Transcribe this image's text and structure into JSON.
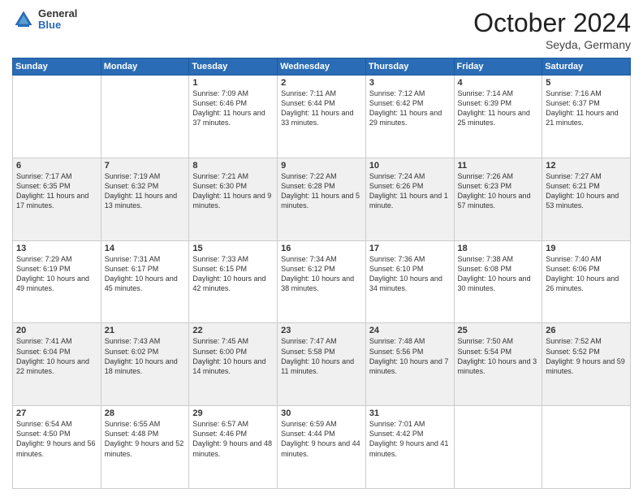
{
  "header": {
    "logo_general": "General",
    "logo_blue": "Blue",
    "month": "October 2024",
    "location": "Seyda, Germany"
  },
  "weekdays": [
    "Sunday",
    "Monday",
    "Tuesday",
    "Wednesday",
    "Thursday",
    "Friday",
    "Saturday"
  ],
  "rows": [
    {
      "alt": false,
      "cells": [
        {
          "day": "",
          "info": ""
        },
        {
          "day": "",
          "info": ""
        },
        {
          "day": "1",
          "info": "Sunrise: 7:09 AM\nSunset: 6:46 PM\nDaylight: 11 hours\nand 37 minutes."
        },
        {
          "day": "2",
          "info": "Sunrise: 7:11 AM\nSunset: 6:44 PM\nDaylight: 11 hours\nand 33 minutes."
        },
        {
          "day": "3",
          "info": "Sunrise: 7:12 AM\nSunset: 6:42 PM\nDaylight: 11 hours\nand 29 minutes."
        },
        {
          "day": "4",
          "info": "Sunrise: 7:14 AM\nSunset: 6:39 PM\nDaylight: 11 hours\nand 25 minutes."
        },
        {
          "day": "5",
          "info": "Sunrise: 7:16 AM\nSunset: 6:37 PM\nDaylight: 11 hours\nand 21 minutes."
        }
      ]
    },
    {
      "alt": true,
      "cells": [
        {
          "day": "6",
          "info": "Sunrise: 7:17 AM\nSunset: 6:35 PM\nDaylight: 11 hours\nand 17 minutes."
        },
        {
          "day": "7",
          "info": "Sunrise: 7:19 AM\nSunset: 6:32 PM\nDaylight: 11 hours\nand 13 minutes."
        },
        {
          "day": "8",
          "info": "Sunrise: 7:21 AM\nSunset: 6:30 PM\nDaylight: 11 hours\nand 9 minutes."
        },
        {
          "day": "9",
          "info": "Sunrise: 7:22 AM\nSunset: 6:28 PM\nDaylight: 11 hours\nand 5 minutes."
        },
        {
          "day": "10",
          "info": "Sunrise: 7:24 AM\nSunset: 6:26 PM\nDaylight: 11 hours\nand 1 minute."
        },
        {
          "day": "11",
          "info": "Sunrise: 7:26 AM\nSunset: 6:23 PM\nDaylight: 10 hours\nand 57 minutes."
        },
        {
          "day": "12",
          "info": "Sunrise: 7:27 AM\nSunset: 6:21 PM\nDaylight: 10 hours\nand 53 minutes."
        }
      ]
    },
    {
      "alt": false,
      "cells": [
        {
          "day": "13",
          "info": "Sunrise: 7:29 AM\nSunset: 6:19 PM\nDaylight: 10 hours\nand 49 minutes."
        },
        {
          "day": "14",
          "info": "Sunrise: 7:31 AM\nSunset: 6:17 PM\nDaylight: 10 hours\nand 45 minutes."
        },
        {
          "day": "15",
          "info": "Sunrise: 7:33 AM\nSunset: 6:15 PM\nDaylight: 10 hours\nand 42 minutes."
        },
        {
          "day": "16",
          "info": "Sunrise: 7:34 AM\nSunset: 6:12 PM\nDaylight: 10 hours\nand 38 minutes."
        },
        {
          "day": "17",
          "info": "Sunrise: 7:36 AM\nSunset: 6:10 PM\nDaylight: 10 hours\nand 34 minutes."
        },
        {
          "day": "18",
          "info": "Sunrise: 7:38 AM\nSunset: 6:08 PM\nDaylight: 10 hours\nand 30 minutes."
        },
        {
          "day": "19",
          "info": "Sunrise: 7:40 AM\nSunset: 6:06 PM\nDaylight: 10 hours\nand 26 minutes."
        }
      ]
    },
    {
      "alt": true,
      "cells": [
        {
          "day": "20",
          "info": "Sunrise: 7:41 AM\nSunset: 6:04 PM\nDaylight: 10 hours\nand 22 minutes."
        },
        {
          "day": "21",
          "info": "Sunrise: 7:43 AM\nSunset: 6:02 PM\nDaylight: 10 hours\nand 18 minutes."
        },
        {
          "day": "22",
          "info": "Sunrise: 7:45 AM\nSunset: 6:00 PM\nDaylight: 10 hours\nand 14 minutes."
        },
        {
          "day": "23",
          "info": "Sunrise: 7:47 AM\nSunset: 5:58 PM\nDaylight: 10 hours\nand 11 minutes."
        },
        {
          "day": "24",
          "info": "Sunrise: 7:48 AM\nSunset: 5:56 PM\nDaylight: 10 hours\nand 7 minutes."
        },
        {
          "day": "25",
          "info": "Sunrise: 7:50 AM\nSunset: 5:54 PM\nDaylight: 10 hours\nand 3 minutes."
        },
        {
          "day": "26",
          "info": "Sunrise: 7:52 AM\nSunset: 5:52 PM\nDaylight: 9 hours\nand 59 minutes."
        }
      ]
    },
    {
      "alt": false,
      "cells": [
        {
          "day": "27",
          "info": "Sunrise: 6:54 AM\nSunset: 4:50 PM\nDaylight: 9 hours\nand 56 minutes."
        },
        {
          "day": "28",
          "info": "Sunrise: 6:55 AM\nSunset: 4:48 PM\nDaylight: 9 hours\nand 52 minutes."
        },
        {
          "day": "29",
          "info": "Sunrise: 6:57 AM\nSunset: 4:46 PM\nDaylight: 9 hours\nand 48 minutes."
        },
        {
          "day": "30",
          "info": "Sunrise: 6:59 AM\nSunset: 4:44 PM\nDaylight: 9 hours\nand 44 minutes."
        },
        {
          "day": "31",
          "info": "Sunrise: 7:01 AM\nSunset: 4:42 PM\nDaylight: 9 hours\nand 41 minutes."
        },
        {
          "day": "",
          "info": ""
        },
        {
          "day": "",
          "info": ""
        }
      ]
    }
  ]
}
